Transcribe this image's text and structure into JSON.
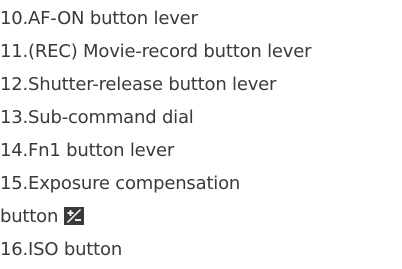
{
  "items": [
    {
      "number": "10.",
      "text": "AF-ON button lever"
    },
    {
      "number": "11.",
      "text": "(REC) Movie-record button lever"
    },
    {
      "number": "12.",
      "text": "Shutter-release button lever"
    },
    {
      "number": "13.",
      "text": "Sub-command dial"
    },
    {
      "number": "14.",
      "text": "Fn1 button lever"
    },
    {
      "number": "15.",
      "text": "Exposure compensation"
    },
    {
      "text": "button",
      "icon": "exposure-compensation-icon"
    },
    {
      "number": "16.",
      "text": "ISO button"
    }
  ],
  "colors": {
    "text": "#3a3a3a",
    "icon_fill": "#3a3a3a",
    "icon_glyph": "#ffffff"
  }
}
